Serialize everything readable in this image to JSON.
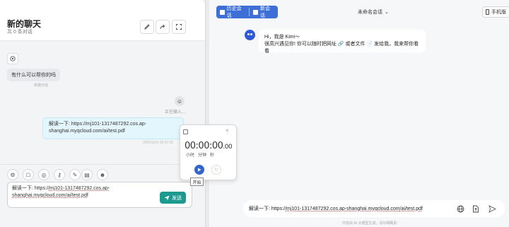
{
  "chat": {
    "title": "新的聊天",
    "subtitle": "共 0 条对话",
    "bot_greeting": "有什么可以帮你的吗",
    "bot_meta": "新建对话",
    "typing": "正在输入…",
    "user_message": "解读一下: https://mj101-1317487292.cos.ap-shanghai.myqcloud.com/ai/test.pdf",
    "user_meta": "2025/3/14 15:47:20",
    "input_prefix": "解读一下: https://",
    "input_url_1": "mj101-1317487292.cos.ap-",
    "input_url_2": "shanghai.myqcloud.com",
    "input_suffix": "/ai/test.pdf",
    "send_label": "发送"
  },
  "right": {
    "history_label": "历史会话",
    "new_label": "新会话",
    "conversation_name": "未命名会话",
    "mobile_label": "手机版",
    "kimi_line1": "Hi，我是 Kimi～",
    "kimi_line2": "很高兴遇见你! 你可以随时把网址 🔗 或者文件 📄 发给我，我来帮你看看",
    "input_prefix": "解读一下: https://",
    "input_url": "mj101-1317487292.cos.ap-shanghai.myqcloud.com",
    "input_suffix": "/ai/test.pdf",
    "footnote": "内容由 AI 大模型生成，请仔细甄别"
  },
  "timer": {
    "display_main": "00:00:00",
    "display_ms": ".00",
    "unit_hour": "小时",
    "unit_min": "分钟",
    "unit_sec": "秒",
    "tooltip": "开始"
  },
  "colors": {
    "accent": "#3d6fd6",
    "send": "#1c9a8f",
    "user_bubble": "#e3f6fd",
    "kimi": "#2d59d8"
  }
}
